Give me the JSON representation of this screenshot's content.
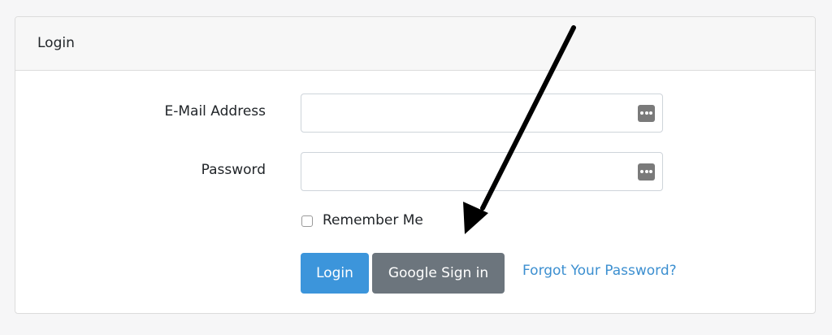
{
  "card": {
    "header_title": "Login"
  },
  "form": {
    "email_label": "E-Mail Address",
    "password_label": "Password",
    "remember_label": "Remember Me",
    "login_button": "Login",
    "google_button": "Google Sign in",
    "forgot_link": "Forgot Your Password?",
    "email_value": "",
    "password_value": ""
  },
  "colors": {
    "primary": "#3c95db",
    "secondary": "#6c757d",
    "link": "#3c8fd0",
    "arrow": "#000000"
  },
  "icons": {
    "password_manager": "password-manager-dots-icon",
    "annotation_arrow": "pointer-arrow-icon"
  }
}
